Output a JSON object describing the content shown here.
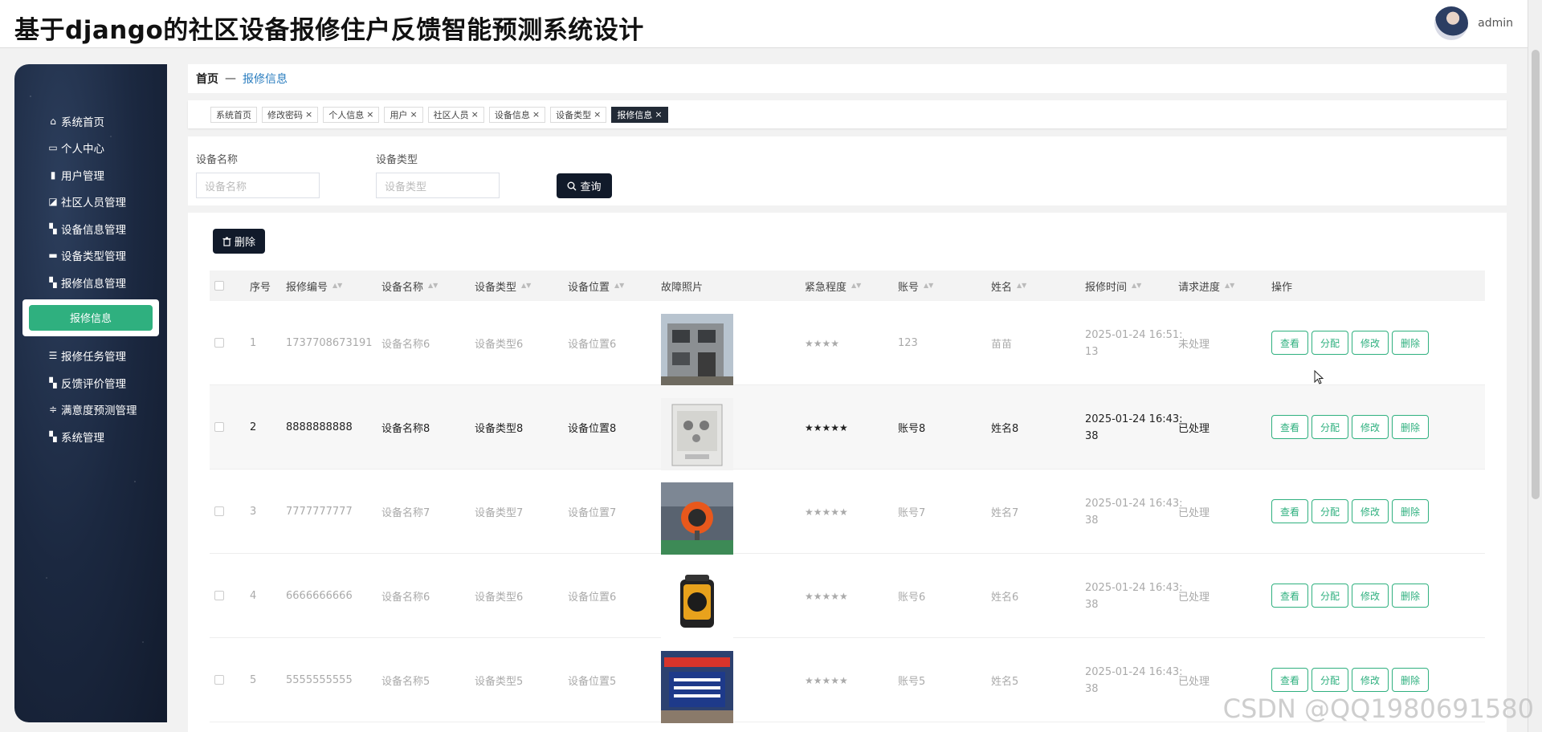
{
  "header": {
    "title": "基于django的社区设备报修住户反馈智能预测系统设计",
    "username": "admin"
  },
  "sidebar": {
    "items": [
      {
        "label": "系统首页",
        "icon": "home-icon"
      },
      {
        "label": "个人中心",
        "icon": "card-icon"
      },
      {
        "label": "用户管理",
        "icon": "clipboard-icon"
      },
      {
        "label": "社区人员管理",
        "icon": "chart-icon"
      },
      {
        "label": "设备信息管理",
        "icon": "grid-icon"
      },
      {
        "label": "设备类型管理",
        "icon": "bag-icon"
      },
      {
        "label": "报修信息管理",
        "icon": "grid-icon"
      }
    ],
    "sub_item": "报修信息",
    "items_after": [
      {
        "label": "报修任务管理",
        "icon": "list-icon"
      },
      {
        "label": "反馈评价管理",
        "icon": "grid-icon"
      },
      {
        "label": "满意度预测管理",
        "icon": "sliders-icon"
      },
      {
        "label": "系统管理",
        "icon": "grid-icon"
      }
    ]
  },
  "breadcrumb": {
    "home": "首页",
    "sep": "—",
    "current": "报修信息"
  },
  "tabs": [
    {
      "label": "系统首页",
      "closable": false
    },
    {
      "label": "修改密码",
      "closable": true
    },
    {
      "label": "个人信息",
      "closable": true
    },
    {
      "label": "用户",
      "closable": true
    },
    {
      "label": "社区人员",
      "closable": true
    },
    {
      "label": "设备信息",
      "closable": true
    },
    {
      "label": "设备类型",
      "closable": true
    },
    {
      "label": "报修信息",
      "closable": true,
      "active": true
    }
  ],
  "search": {
    "name_label": "设备名称",
    "name_placeholder": "设备名称",
    "type_label": "设备类型",
    "type_placeholder": "设备类型",
    "query_label": "查询"
  },
  "toolbar": {
    "delete_label": "删除"
  },
  "table": {
    "columns": [
      "序号",
      "报修编号",
      "设备名称",
      "设备类型",
      "设备位置",
      "故障照片",
      "紧急程度",
      "账号",
      "姓名",
      "报修时间",
      "请求进度",
      "操作"
    ],
    "actions": [
      "查看",
      "分配",
      "修改",
      "删除"
    ],
    "rows": [
      {
        "index": "1",
        "code": "1737708673191",
        "name": "设备名称6",
        "type": "设备类型6",
        "location": "设备位置6",
        "photo": "building",
        "urgency": "★★★★",
        "account": "123",
        "person": "苗苗",
        "time": "2025-01-24 16:51:\n13",
        "status": "未处理"
      },
      {
        "index": "2",
        "code": "8888888888",
        "name": "设备名称8",
        "type": "设备类型8",
        "location": "设备位置8",
        "photo": "cabinet",
        "urgency": "★★★★★",
        "account": "账号8",
        "person": "姓名8",
        "time": "2025-01-24 16:43:\n38",
        "status": "已处理"
      },
      {
        "index": "3",
        "code": "7777777777",
        "name": "设备名称7",
        "type": "设备类型7",
        "location": "设备位置7",
        "photo": "detector",
        "urgency": "★★★★★",
        "account": "账号7",
        "person": "姓名7",
        "time": "2025-01-24 16:43:\n38",
        "status": "已处理"
      },
      {
        "index": "4",
        "code": "6666666666",
        "name": "设备名称6",
        "type": "设备类型6",
        "location": "设备位置6",
        "photo": "speaker",
        "urgency": "★★★★★",
        "account": "账号6",
        "person": "姓名6",
        "time": "2025-01-24 16:43:\n38",
        "status": "已处理"
      },
      {
        "index": "5",
        "code": "5555555555",
        "name": "设备名称5",
        "type": "设备类型5",
        "location": "设备位置5",
        "photo": "sign",
        "urgency": "★★★★★",
        "account": "账号5",
        "person": "姓名5",
        "time": "2025-01-24 16:43:\n38",
        "status": "已处理"
      }
    ]
  },
  "colors": {
    "accent": "#2fb07f",
    "dark": "#111a2a",
    "link": "#2a7dbf"
  },
  "watermark": "CSDN @QQ1980691580"
}
